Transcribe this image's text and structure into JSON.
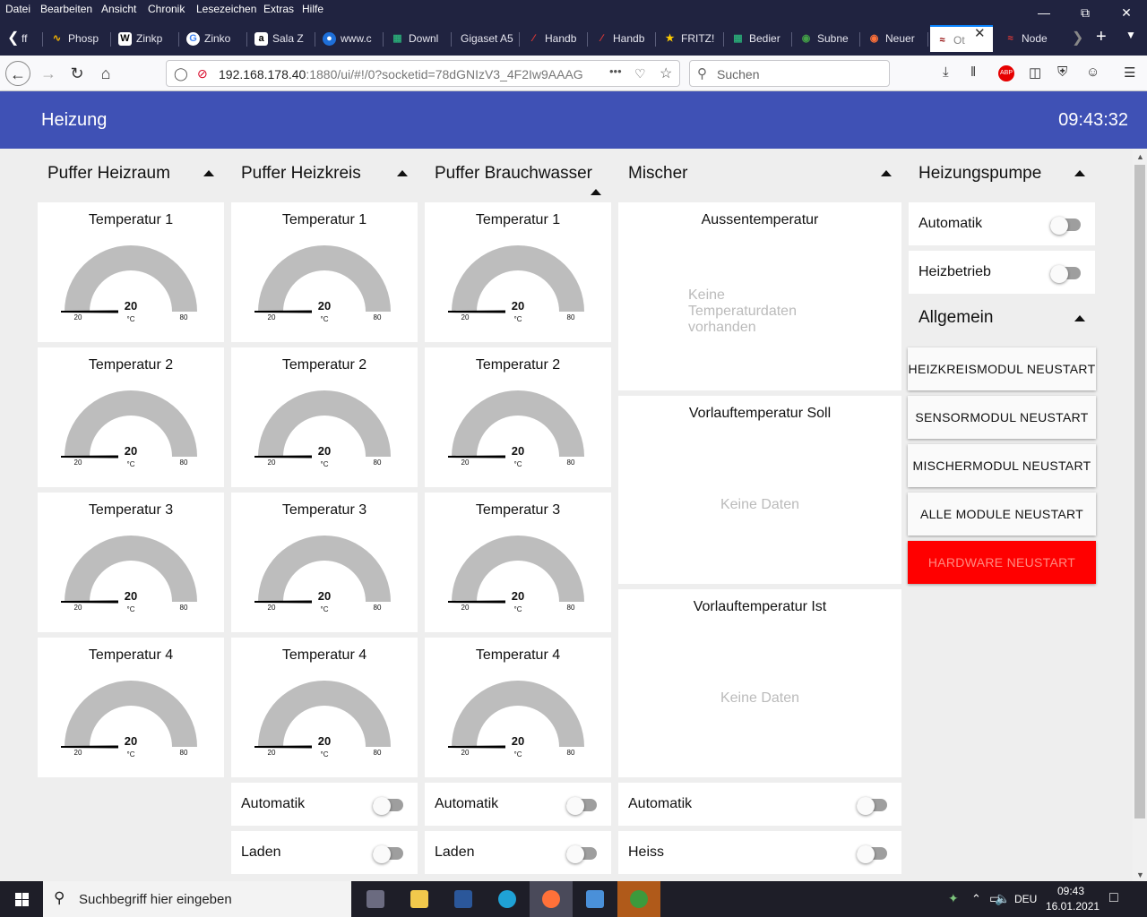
{
  "browser": {
    "menu": [
      "Datei",
      "Bearbeiten",
      "Ansicht",
      "Chronik",
      "Lesezeichen",
      "Extras",
      "Hilfe"
    ],
    "tabs": [
      {
        "label": "ff"
      },
      {
        "label": "Phosp"
      },
      {
        "label": "Zinkp"
      },
      {
        "label": "Zinko"
      },
      {
        "label": "Sala Z"
      },
      {
        "label": "www.c"
      },
      {
        "label": "Downl"
      },
      {
        "label": "Gigaset A5"
      },
      {
        "label": "Handb"
      },
      {
        "label": "Handb"
      },
      {
        "label": "FRITZ!"
      },
      {
        "label": "Bedier"
      },
      {
        "label": "Subne"
      },
      {
        "label": "Neuer"
      },
      {
        "label": "Ot"
      },
      {
        "label": "Node"
      }
    ],
    "url_host": "192.168.178.40",
    "url_path": ":1880/ui/#!/0?socketid=78dGNIzV3_4F2Iw9AAAG",
    "search_placeholder": "Suchen",
    "url_more": "•••"
  },
  "dashboard": {
    "title": "Heizung",
    "clock": "09:43:32",
    "gauge_min": "20",
    "gauge_max": "80",
    "gauge_unit": "°C",
    "gauge_value": "20",
    "groups": {
      "puffer_heizraum": {
        "title": "Puffer Heizraum"
      },
      "puffer_heizkreis": {
        "title": "Puffer Heizkreis"
      },
      "puffer_brauchwasser": {
        "title": "Puffer Brauchwasser"
      },
      "mischer": {
        "title": "Mischer"
      },
      "heizungspumpe": {
        "title": "Heizungspumpe"
      },
      "allgemein": {
        "title": "Allgemein"
      }
    },
    "gauge_labels": [
      "Temperatur 1",
      "Temperatur 2",
      "Temperatur 3",
      "Temperatur 4"
    ],
    "mischer_cards": {
      "aussen_title": "Aussentemperatur",
      "aussen_nodata": "Keine Temperaturdaten vorhanden",
      "soll_title": "Vorlauftemperatur Soll",
      "soll_nodata": "Keine Daten",
      "ist_title": "Vorlauftemperatur Ist",
      "ist_nodata": "Keine Daten"
    },
    "switches": {
      "automatik": "Automatik",
      "laden": "Laden",
      "heiss": "Heiss",
      "heizbetrieb": "Heizbetrieb"
    },
    "buttons": {
      "heizkreismodul": "HEIZKREISMODUL NEUSTART",
      "sensormodul": "SENSORMODUL NEUSTART",
      "mischermodul": "MISCHERMODUL NEUSTART",
      "alle_module": "ALLE MODULE NEUSTART",
      "hardware": "HARDWARE NEUSTART"
    }
  },
  "taskbar": {
    "search_placeholder": "Suchbegriff hier eingeben",
    "lang": "DEU",
    "time": "09:43",
    "date": "16.01.2021"
  },
  "colors": {
    "header": "#3f51b5",
    "hardware_button": "#ff0000",
    "gauge_arc": "#bdbdbd"
  }
}
